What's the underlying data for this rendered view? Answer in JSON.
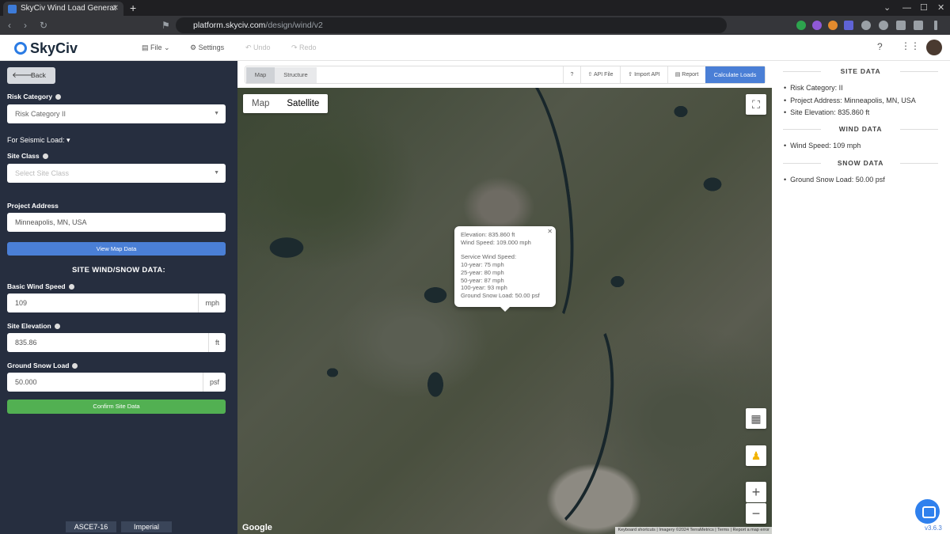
{
  "browser": {
    "tab_title": "SkyCiv Wind Load Generat",
    "new_tab": "+",
    "url_host": "platform.skyciv.com",
    "url_path": "/design/wind/v2"
  },
  "appbar": {
    "logo": "SkyCiv",
    "file": "File",
    "settings": "Settings",
    "undo": "Undo",
    "redo": "Redo"
  },
  "sidebar": {
    "back": "Back",
    "risk_category_label": "Risk Category",
    "risk_category_value": "Risk Category II",
    "seismic_label": "For Seismic Load:",
    "site_class_label": "Site Class",
    "site_class_placeholder": "Select Site Class",
    "address_label": "Project Address",
    "address_value": "Minneapolis, MN, USA",
    "view_map_btn": "View Map Data",
    "site_heading": "SITE WIND/SNOW DATA:",
    "wind_label": "Basic Wind Speed",
    "wind_value": "109",
    "wind_unit": "mph",
    "elev_label": "Site Elevation",
    "elev_value": "835.86",
    "elev_unit": "ft",
    "snow_label": "Ground Snow Load",
    "snow_value": "50.000",
    "snow_unit": "psf",
    "confirm_btn": "Confirm Site Data",
    "code": "ASCE7-16",
    "units": "Imperial"
  },
  "toolbar": {
    "tab_map": "Map",
    "tab_structure": "Structure",
    "help": "?",
    "api_file": "API File",
    "import_api": "Import API",
    "report": "Report",
    "calculate": "Calculate Loads"
  },
  "map": {
    "type_map": "Map",
    "type_satellite": "Satellite",
    "popup_elevation": "Elevation: 835.860 ft",
    "popup_wind": "Wind Speed: 109.000 mph",
    "popup_service": "Service Wind Speed:",
    "popup_10": "10-year: 75 mph",
    "popup_25": "25-year: 80 mph",
    "popup_50": "50-year: 87 mph",
    "popup_100": "100-year: 93 mph",
    "popup_snow": "Ground Snow Load: 50.00 psf",
    "google": "Google",
    "attribution": "Keyboard shortcuts | Imagery ©2024 TerraMetrics | Terms | Report a map error"
  },
  "right_panel": {
    "site_head": "SITE DATA",
    "risk": "Risk Category: II",
    "address": "Project Address: Minneapolis, MN, USA",
    "elevation": "Site Elevation: 835.860 ft",
    "wind_head": "WIND DATA",
    "wind_speed": "Wind Speed: 109 mph",
    "snow_head": "SNOW DATA",
    "snow_load": "Ground Snow Load: 50.00 psf",
    "version": "v3.6.3"
  }
}
